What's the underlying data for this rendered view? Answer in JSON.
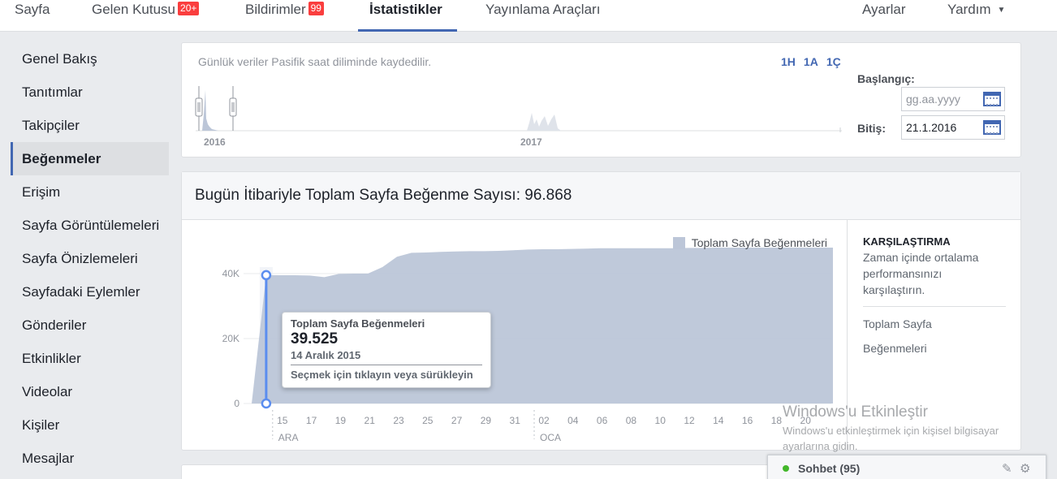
{
  "nav": {
    "items": [
      {
        "label": "Sayfa",
        "badge": ""
      },
      {
        "label": "Gelen Kutusu",
        "badge": "20+"
      },
      {
        "label": "Bildirimler",
        "badge": "99"
      },
      {
        "label": "İstatistikler",
        "badge": ""
      },
      {
        "label": "Yayınlama Araçları",
        "badge": ""
      }
    ],
    "right": [
      {
        "label": "Ayarlar"
      },
      {
        "label": "Yardım"
      }
    ],
    "active": "İstatistikler"
  },
  "sidebar": {
    "items": [
      {
        "label": "Genel Bakış"
      },
      {
        "label": "Tanıtımlar"
      },
      {
        "label": "Takipçiler"
      },
      {
        "label": "Beğenmeler"
      },
      {
        "label": "Erişim"
      },
      {
        "label": "Sayfa Görüntülemeleri"
      },
      {
        "label": "Sayfa Önizlemeleri"
      },
      {
        "label": "Sayfadaki Eylemler"
      },
      {
        "label": "Gönderiler"
      },
      {
        "label": "Etkinlikler"
      },
      {
        "label": "Videolar"
      },
      {
        "label": "Kişiler"
      },
      {
        "label": "Mesajlar"
      }
    ],
    "active": "Beğenmeler"
  },
  "range": {
    "notice": "Günlük veriler Pasifik saat diliminde kaydedilir.",
    "presets": [
      "1H",
      "1A",
      "1Ç"
    ],
    "year_labels": [
      "2016",
      "2017"
    ],
    "start_label": "Başlangıç:",
    "start_placeholder": "gg.aa.yyyy",
    "end_label": "Bitiş:",
    "end_value": "21.1.2016"
  },
  "main": {
    "title": "Bugün İtibariyle Toplam Sayfa Beğenme Sayısı: 96.868",
    "legend": "Toplam Sayfa Beğenmeleri",
    "compare": {
      "title": "KARŞILAŞTIRMA",
      "desc": "Zaman içinde ortalama performansınızı karşılaştırın.",
      "links": [
        "Toplam Sayfa",
        "Beğenmeleri"
      ]
    },
    "tooltip": {
      "series": "Toplam Sayfa Beğenmeleri",
      "value": "39.525",
      "date": "14 Aralık 2015",
      "hint": "Seçmek için tıklayın veya sürükleyin"
    }
  },
  "chart_data": {
    "type": "area",
    "title": "",
    "xlabel": "",
    "ylabel": "",
    "y_tick_labels": [
      "0",
      "20K",
      "40K"
    ],
    "ylim": [
      0,
      50000
    ],
    "x_tick_labels": [
      "15",
      "17",
      "19",
      "21",
      "23",
      "25",
      "27",
      "29",
      "31",
      "02",
      "04",
      "06",
      "08",
      "10",
      "12",
      "14",
      "16",
      "18",
      "20"
    ],
    "month_labels": [
      {
        "label": "ARA",
        "at": "15"
      },
      {
        "label": "OCA",
        "at": "02"
      }
    ],
    "series": [
      {
        "name": "Toplam Sayfa Beğenmeleri",
        "color": "#bcc6d8",
        "x": [
          13,
          14,
          15,
          16,
          17,
          18,
          19,
          20,
          21,
          22,
          23,
          24,
          25,
          26,
          27,
          28,
          29,
          30,
          31,
          32,
          33,
          34,
          35,
          36,
          37,
          38,
          39,
          40,
          41,
          42,
          43,
          44,
          45,
          46,
          47,
          48,
          49,
          50,
          51,
          52,
          53
        ],
        "values": [
          0,
          39525,
          39500,
          39500,
          39400,
          38900,
          39900,
          40000,
          40000,
          42000,
          45200,
          46400,
          46500,
          46700,
          46800,
          46900,
          46900,
          47000,
          47200,
          47400,
          47500,
          47500,
          47600,
          47700,
          47800,
          47800,
          47800,
          47800,
          47800,
          47800,
          47900,
          47900,
          48000,
          48000,
          48000,
          48000,
          48000,
          48000,
          48000,
          48000,
          48000
        ]
      }
    ],
    "highlight": {
      "date": "14 Aralık 2015",
      "value": 39525
    },
    "grid": true,
    "legend_position": "top-right"
  },
  "chat": {
    "label": "Sohbet (95)"
  },
  "watermark": {
    "title": "Windows'u Etkinleştir",
    "sub": "Windows'u etkinleştirmek için kişisel bilgisayar ayarlarına gidin."
  }
}
